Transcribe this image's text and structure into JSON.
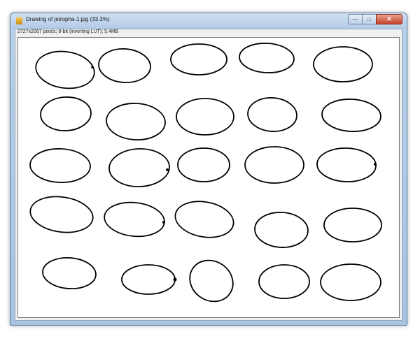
{
  "window": {
    "title": "Drawing of jetropha-1.jpg (33.3%)",
    "info": "2727x2067 pixels; 8-bit (inverting LUT); 5.4MB",
    "buttons": {
      "minimize": "—",
      "maximize": "□",
      "close": "✕"
    }
  },
  "image": {
    "content": "seed-outline-drawing",
    "outline_count": 25
  }
}
